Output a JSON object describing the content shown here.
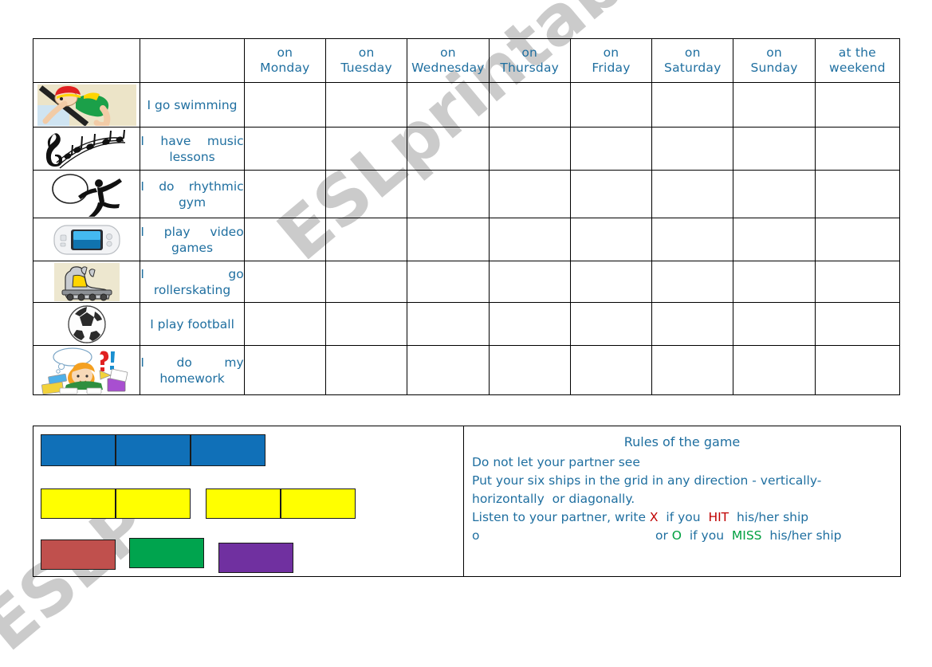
{
  "worksheet": {
    "watermark_main": "ESLprintables.com",
    "watermark_secondary": "ESLP"
  },
  "activity_table": {
    "headers": [
      {
        "name": "picture",
        "label": ""
      },
      {
        "name": "activity",
        "label": ""
      },
      {
        "name": "monday",
        "line1": "on",
        "line2": "Monday"
      },
      {
        "name": "tuesday",
        "line1": "on",
        "line2": "Tuesday"
      },
      {
        "name": "wednesday",
        "line1": "on",
        "line2": "Wednesday"
      },
      {
        "name": "thursday",
        "line1": "on",
        "line2": "Thursday"
      },
      {
        "name": "friday",
        "line1": "on",
        "line2": "Friday"
      },
      {
        "name": "saturday",
        "line1": "on",
        "line2": "Saturday"
      },
      {
        "name": "sunday",
        "line1": "on",
        "line2": "Sunday"
      },
      {
        "name": "weekend",
        "line1": "at the",
        "line2": "weekend"
      }
    ],
    "rows": [
      {
        "icon": "swimmer-icon",
        "label": "I go swimming"
      },
      {
        "icon": "music-notes-icon",
        "label": "I have music lessons"
      },
      {
        "icon": "rhythmic-gymnast-icon",
        "label": "I do rhythmic gym"
      },
      {
        "icon": "handheld-console-icon",
        "label": "I play video games"
      },
      {
        "icon": "rollerskate-icon",
        "label": "I go rollerskating"
      },
      {
        "icon": "football-icon",
        "label": "I play football"
      },
      {
        "icon": "homework-child-icon",
        "label": "I do my homework"
      }
    ]
  },
  "ships": {
    "items": [
      {
        "name": "ship-blue",
        "color": "#1070b8",
        "cells": 3
      },
      {
        "name": "ship-yellow-a",
        "color": "#ffff00",
        "cells": 2
      },
      {
        "name": "ship-yellow-b",
        "color": "#ffff00",
        "cells": 2
      },
      {
        "name": "ship-red",
        "color": "#c0504d",
        "cells": 1
      },
      {
        "name": "ship-green",
        "color": "#00a44e",
        "cells": 1
      },
      {
        "name": "ship-purple",
        "color": "#7030a0",
        "cells": 1
      }
    ]
  },
  "rules": {
    "title": "Rules of the game",
    "line1": "Do not let your partner see",
    "line2": "Put your six ships in the grid in any direction - vertically-",
    "line3": "horizontally  or diagonally.",
    "line4_pre": "Listen to your partner, write ",
    "line4_x": "X",
    "line4_mid": "  if you  ",
    "line4_hit": "HIT",
    "line4_post": "  his/her ship",
    "line5_lead": "o",
    "line5_pre": "or ",
    "line5_o": "O",
    "line5_mid": "  if you  ",
    "line5_miss": "MISS",
    "line5_post": "  his/her ship",
    "hit_color": "#c00000",
    "miss_color": "#00a040"
  },
  "colors": {
    "text_blue": "#1f6fa0",
    "border": "#000000",
    "watermark": "#cbcbcb"
  }
}
